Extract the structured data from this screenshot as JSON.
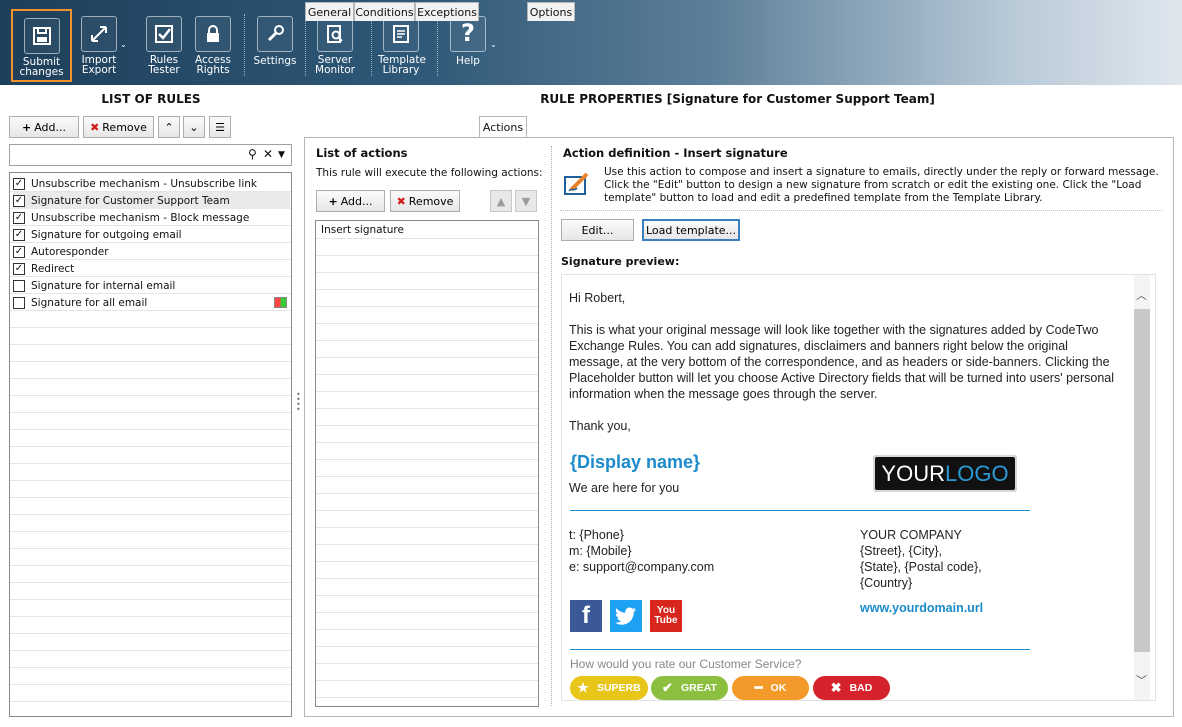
{
  "toolbar": {
    "submit": "Submit changes",
    "import_export_1": "Import",
    "import_export_2": "Export",
    "rules_tester_1": "Rules",
    "rules_tester_2": "Tester",
    "access_rights_1": "Access",
    "access_rights_2": "Rights",
    "settings": "Settings",
    "server_monitor_1": "Server",
    "server_monitor_2": "Monitor",
    "template_library_1": "Template",
    "template_library_2": "Library",
    "help": "Help"
  },
  "left": {
    "title": "LIST OF RULES",
    "add": "Add...",
    "remove": "Remove",
    "rules": [
      {
        "label": "Unsubscribe mechanism - Unsubscribe link",
        "checked": true
      },
      {
        "label": "Signature for Customer Support Team",
        "checked": true
      },
      {
        "label": "Unsubscribe mechanism - Block message",
        "checked": true
      },
      {
        "label": "Signature for outgoing email",
        "checked": true
      },
      {
        "label": "Autoresponder",
        "checked": true
      },
      {
        "label": "Redirect",
        "checked": true
      },
      {
        "label": "Signature for internal email",
        "checked": false
      },
      {
        "label": "Signature for all email",
        "checked": false
      }
    ]
  },
  "right": {
    "title": "RULE PROPERTIES [Signature for Customer Support Team]",
    "tabs": [
      "General",
      "Conditions",
      "Exceptions",
      "Actions",
      "Options"
    ],
    "actions": {
      "title": "List of actions",
      "subtitle": "This rule will execute the following actions:",
      "add": "Add...",
      "remove": "Remove",
      "items": [
        "Insert signature"
      ]
    },
    "definition": {
      "title": "Action definition - Insert signature",
      "desc": "Use this action to compose and insert a signature to emails, directly under the reply or forward message. Click the \"Edit\" button to design a new signature from scratch or edit the existing one. Click the \"Load template\" button to load and edit a predefined template from the Template Library.",
      "edit": "Edit...",
      "load": "Load template...",
      "preview_label": "Signature preview:"
    },
    "preview": {
      "greeting": "Hi Robert,",
      "body": "This is what your original message will look like together with the signatures added by CodeTwo Exchange Rules. You can add signatures, disclaimers and banners right below the original message, at the very bottom of the correspondence, and as headers or side-banners. Clicking the Placeholder button will let you choose Active Directory fields that will be turned into users' personal information when the message goes through the server.",
      "thanks": "Thank you,",
      "display_name": "{Display name}",
      "tagline": "We are here for you",
      "logo_a": "YOUR",
      "logo_b": "LOGO",
      "phone": "t: {Phone}",
      "mobile": "m: {Mobile}",
      "email": "e: support@company.com",
      "company": "YOUR COMPANY",
      "street": "{Street}, {City},",
      "state": "{State}, {Postal code},",
      "country": "{Country}",
      "url": "www.yourdomain.url",
      "rate_q": "How would you rate our Customer Service?",
      "ratings": [
        {
          "label": "SUPERB",
          "color": "#e8c619"
        },
        {
          "label": "GREAT",
          "color": "#8cbf3f"
        },
        {
          "label": "OK",
          "color": "#f39a2a"
        },
        {
          "label": "BAD",
          "color": "#d5222b"
        }
      ]
    }
  }
}
